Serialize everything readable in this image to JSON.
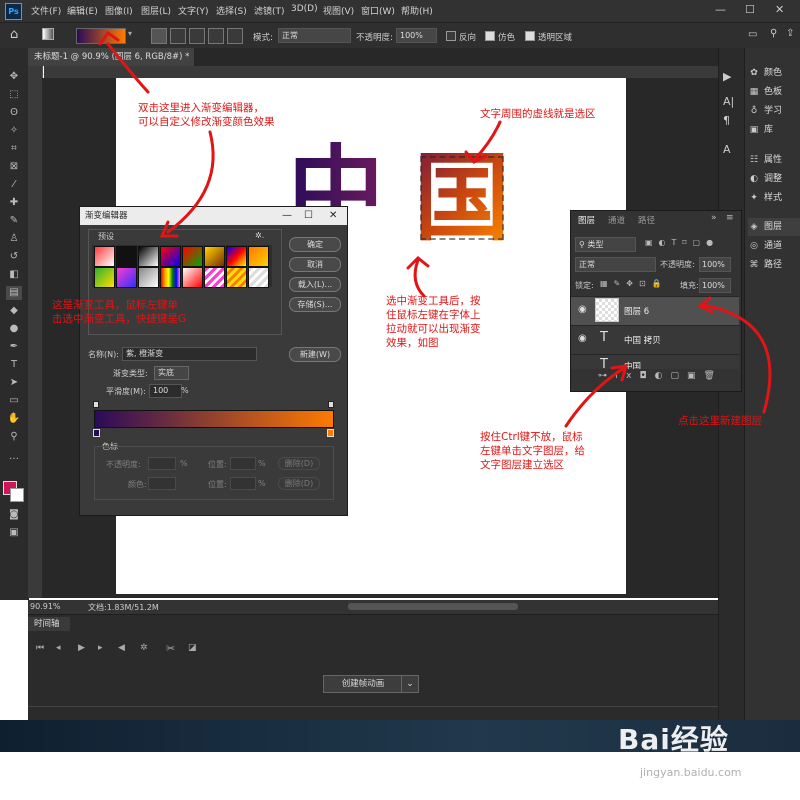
{
  "app": {
    "logo": "Ps",
    "menu": [
      "文件(F)",
      "编辑(E)",
      "图像(I)",
      "图层(L)",
      "文字(Y)",
      "选择(S)",
      "滤镜(T)",
      "3D(D)",
      "视图(V)",
      "窗口(W)",
      "帮助(H)"
    ],
    "window_controls": {
      "minimize": "—",
      "maximize": "☐",
      "close": "✕"
    }
  },
  "options": {
    "mode_label": "模式:",
    "mode_value": "正常",
    "opacity_label": "不透明度:",
    "opacity_value": "100%",
    "reverse_label": "反向",
    "dither_label": "仿色",
    "transparency_label": "透明区域",
    "gradient_colors": [
      "#2a0b5a",
      "#ff7a00"
    ]
  },
  "document": {
    "tab_title": "未标题-1 @ 90.9% (图层 6, RGB/8#) *",
    "tab_close": "×",
    "zoom": "90.91%",
    "doc_info": "文档:1.83M/51.2M",
    "chars": [
      "中",
      "国"
    ]
  },
  "annotations": {
    "a1_line1": "双击这里进入渐变编辑器，",
    "a1_line2": "可以自定义修改渐变颜色效果",
    "a2": "文字周围的虚线就是选区",
    "a3_line1": "这是渐变工具，鼠标左键单",
    "a3_line2": "击选中渐变工具，快捷键是G",
    "a4_line1": "选中渐变工具后，按",
    "a4_line2": "住鼠标左键在字体上",
    "a4_line3": "拉动就可以出现渐变",
    "a4_line4": "效果，如图",
    "a5_line1": "按住Ctrl键不放，鼠标",
    "a5_line2": "左键单击文字图层，给",
    "a5_line3": "文字图层建立选区",
    "a6": "点击这里新建图层"
  },
  "dialog": {
    "title": "渐变编辑器",
    "presets_label": "预设",
    "gear": "✲.",
    "buttons": {
      "ok": "确定",
      "cancel": "取消",
      "load": "载入(L)...",
      "save": "存储(S)...",
      "new": "新建(W)"
    },
    "name_label": "名称(N):",
    "name_value": "紫, 橙渐变",
    "type_label": "渐变类型:",
    "type_value": "实底",
    "smooth_label": "平滑度(M):",
    "smooth_value": "100",
    "smooth_unit": "%",
    "stops_label": "色标",
    "opacity_label": "不透明度:",
    "location_label": "位置:",
    "delete_label": "删除(D)",
    "color_label": "颜色:",
    "percent": "%",
    "presets": [
      "linear-gradient(135deg,#ff3b3b,#ffffff)",
      "linear-gradient(135deg,#111,#111)",
      "linear-gradient(135deg,#000,#fff)",
      "linear-gradient(135deg,#ff0000,#0000ff)",
      "linear-gradient(135deg,#ff0000,#00aa00)",
      "linear-gradient(135deg,#ffd700,#7a2b00)",
      "linear-gradient(135deg,#0000ff,#ff0000,#ffff00)",
      "linear-gradient(135deg,#ff7a00,#ffd000)",
      "linear-gradient(135deg,#2fb02f,#ffe000)",
      "linear-gradient(135deg,#ff3bd0,#3030ff)",
      "linear-gradient(135deg,#888,#fff)",
      "linear-gradient(90deg,red,orange,yellow,green,blue,violet)",
      "linear-gradient(135deg,#ffffff,#ff0000)",
      "repeating-linear-gradient(135deg,#ff3bd0 0 3px,#fff 3px 6px)",
      "repeating-linear-gradient(135deg,#ffe000 0 3px,#ff7a00 3px 6px)",
      "repeating-linear-gradient(135deg,#ddd 0 3px,#fff 3px 6px)"
    ]
  },
  "layers_panel": {
    "tabs": [
      "图层",
      "通道",
      "路径"
    ],
    "filter_label": "类型",
    "blend": "正常",
    "opacity_label": "不透明度:",
    "opacity_value": "100%",
    "lock_label": "锁定:",
    "fill_label": "填充:",
    "fill_value": "100%",
    "layers": [
      {
        "name": "图层 6",
        "kind": "pixel"
      },
      {
        "name": "中国 拷贝",
        "kind": "text"
      },
      {
        "name": "中国",
        "kind": "text"
      }
    ]
  },
  "right_panel": {
    "group1": [
      "颜色",
      "色板",
      "学习",
      "库"
    ],
    "group2": [
      "属性",
      "调整",
      "样式"
    ],
    "group3": [
      "图层",
      "通道",
      "路径"
    ]
  },
  "timeline": {
    "tab": "时间轴",
    "create_button": "创建帧动画"
  },
  "watermark": {
    "brand": "Bai经验",
    "site": "jingyan.baidu.com"
  }
}
